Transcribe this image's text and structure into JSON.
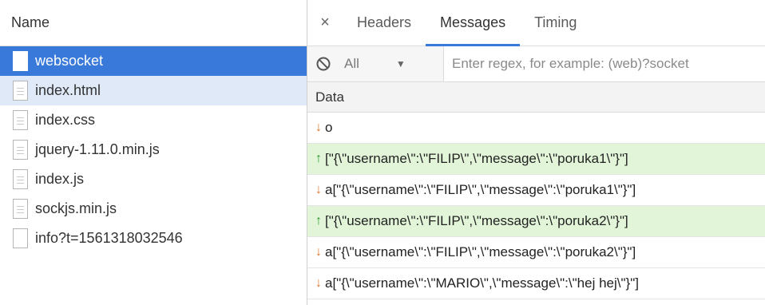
{
  "requests_panel": {
    "header": "Name",
    "items": [
      {
        "name": "websocket",
        "state": "selected"
      },
      {
        "name": "index.html",
        "state": "hover"
      },
      {
        "name": "index.css",
        "state": "normal"
      },
      {
        "name": "jquery-1.11.0.min.js",
        "state": "normal"
      },
      {
        "name": "index.js",
        "state": "normal"
      },
      {
        "name": "sockjs.min.js",
        "state": "normal"
      },
      {
        "name": "info?t=1561318032546",
        "state": "normal"
      }
    ]
  },
  "detail_panel": {
    "close_glyph": "×",
    "tabs": [
      {
        "label": "Headers",
        "active": false
      },
      {
        "label": "Messages",
        "active": true
      },
      {
        "label": "Timing",
        "active": false
      }
    ],
    "filter": {
      "type_value": "All",
      "regex_placeholder": "Enter regex, for example: (web)?socket"
    },
    "column_header": "Data",
    "messages": [
      {
        "direction": "received",
        "text": "o"
      },
      {
        "direction": "sent",
        "text": "[\"{\\\"username\\\":\\\"FILIP\\\",\\\"message\\\":\\\"poruka1\\\"}\"]"
      },
      {
        "direction": "received",
        "text": "a[\"{\\\"username\\\":\\\"FILIP\\\",\\\"message\\\":\\\"poruka1\\\"}\"]"
      },
      {
        "direction": "sent",
        "text": "[\"{\\\"username\\\":\\\"FILIP\\\",\\\"message\\\":\\\"poruka2\\\"}\"]"
      },
      {
        "direction": "received",
        "text": "a[\"{\\\"username\\\":\\\"FILIP\\\",\\\"message\\\":\\\"poruka2\\\"}\"]"
      },
      {
        "direction": "received",
        "text": "a[\"{\\\"username\\\":\\\"MARIO\\\",\\\"message\\\":\\\"hej hej\\\"}\"]"
      }
    ]
  },
  "colors": {
    "accent": "#3879d9",
    "sent_row": "#e2f5d9",
    "received_arrow": "#e07a2e",
    "sent_arrow": "#2e9c2e"
  }
}
